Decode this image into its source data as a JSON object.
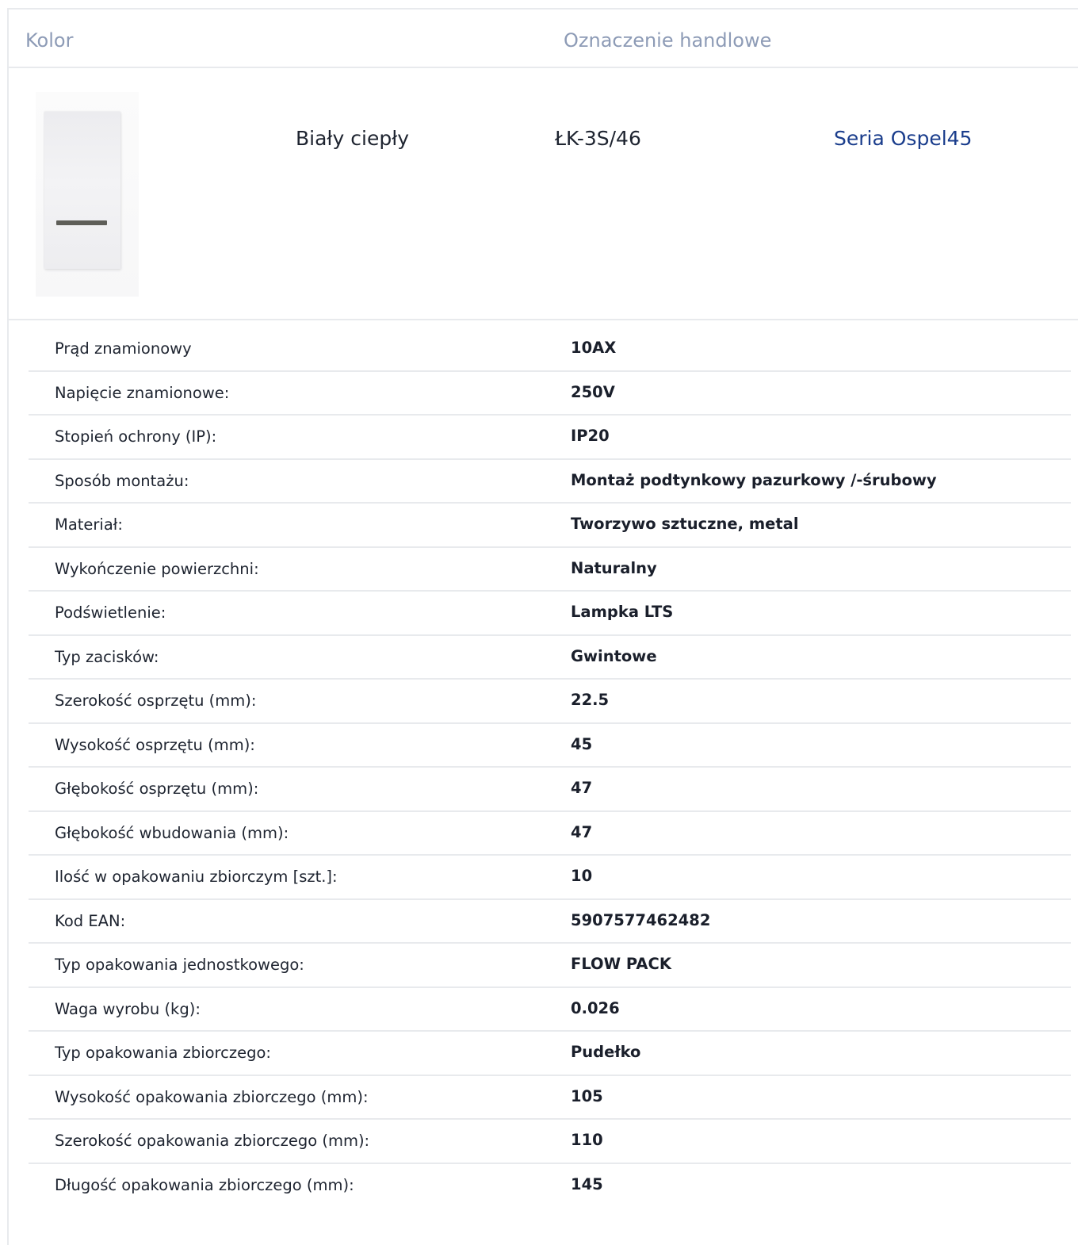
{
  "header": {
    "kolor_label": "Kolor",
    "oznaczenie_label": "Oznaczenie handlowe"
  },
  "product": {
    "image_icon": "light-switch-product-image",
    "color": "Biały ciepły",
    "code": "ŁK-3S/46",
    "series": "Seria Ospel45",
    "series_color": "#1a3d8c"
  },
  "specs": [
    {
      "label": "Prąd znamionowy",
      "value": "10AX"
    },
    {
      "label": "Napięcie znamionowe:",
      "value": "250V"
    },
    {
      "label": "Stopień ochrony (IP):",
      "value": "IP20"
    },
    {
      "label": "Sposób montażu:",
      "value": "Montaż podtynkowy pazurkowy /-śrubowy"
    },
    {
      "label": "Materiał:",
      "value": "Tworzywo sztuczne, metal"
    },
    {
      "label": "Wykończenie powierzchni:",
      "value": "Naturalny"
    },
    {
      "label": "Podświetlenie:",
      "value": "Lampka LTS"
    },
    {
      "label": "Typ zacisków:",
      "value": "Gwintowe"
    },
    {
      "label": "Szerokość osprzętu (mm):",
      "value": "22.5"
    },
    {
      "label": "Wysokość osprzętu (mm):",
      "value": "45"
    },
    {
      "label": "Głębokość osprzętu (mm):",
      "value": "47"
    },
    {
      "label": "Głębokość wbudowania (mm):",
      "value": "47"
    },
    {
      "label": "Ilość w opakowaniu zbiorczym [szt.]:",
      "value": "10"
    },
    {
      "label": "Kod EAN:",
      "value": "5907577462482"
    },
    {
      "label": "Typ opakowania jednostkowego:",
      "value": "FLOW PACK"
    },
    {
      "label": "Waga wyrobu (kg):",
      "value": "0.026"
    },
    {
      "label": "Typ opakowania zbiorczego:",
      "value": "Pudełko"
    },
    {
      "label": "Wysokość opakowania zbiorczego (mm):",
      "value": "105"
    },
    {
      "label": "Szerokość opakowania zbiorczego (mm):",
      "value": "110"
    },
    {
      "label": "Długość opakowania zbiorczego (mm):",
      "value": "145"
    }
  ]
}
